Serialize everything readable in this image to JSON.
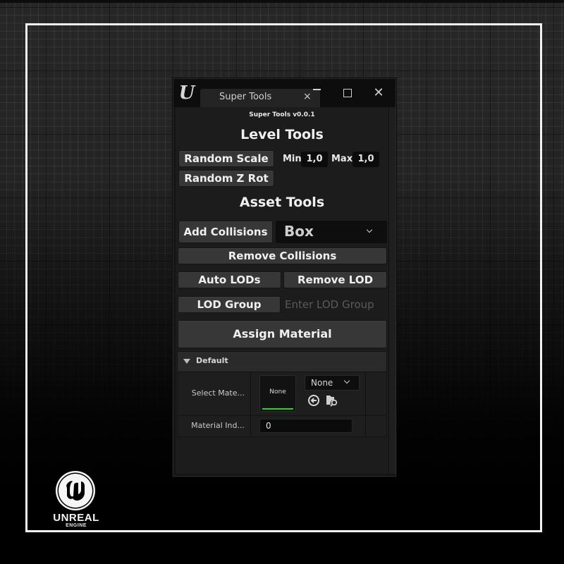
{
  "window": {
    "tab_title": "Super Tools",
    "tab_close_glyph": "×",
    "close_glyph": "✕",
    "logo_glyph": "U"
  },
  "panel": {
    "version": "Super Tools v0.0.1",
    "level_tools": {
      "heading": "Level Tools",
      "random_scale_label": "Random Scale",
      "min_label": "Min",
      "min_value": "1,0",
      "max_label": "Max",
      "max_value": "1,0",
      "random_z_rot_label": "Random Z Rot"
    },
    "asset_tools": {
      "heading": "Asset Tools",
      "add_collisions_label": "Add Collisions",
      "collision_type_selected": "Box",
      "remove_collisions_label": "Remove Collisions",
      "auto_lods_label": "Auto LODs",
      "remove_lod_label": "Remove LOD",
      "lod_group_label": "LOD Group",
      "lod_group_placeholder": "Enter LOD Group",
      "assign_material_label": "Assign Material"
    },
    "details": {
      "category": "Default",
      "select_material_label": "Select Mate...",
      "material_thumbnail_text": "None",
      "material_combo_value": "None",
      "material_index_label": "Material Ind...",
      "material_index_value": "0"
    }
  },
  "branding": {
    "wordmark": "UNREAL",
    "subtitle": "ENGINE"
  },
  "colors": {
    "accent_green": "#2ed12e",
    "frame": "#f2f2f2",
    "button": "#373737"
  }
}
